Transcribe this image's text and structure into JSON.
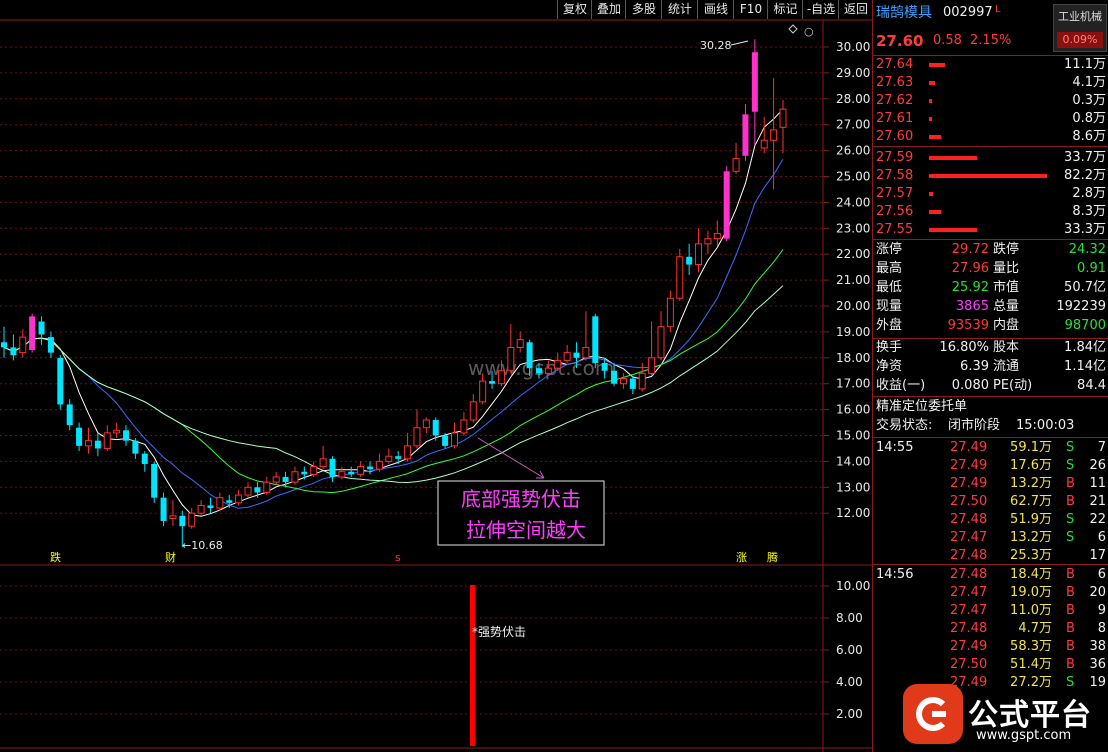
{
  "toolbar": {
    "items": [
      "复权",
      "叠加",
      "多股",
      "统计",
      "画线",
      "F10",
      "标记",
      "-自选",
      "返回"
    ]
  },
  "price_axis": {
    "labels": [
      "30.00",
      "29.00",
      "28.00",
      "27.00",
      "26.00",
      "25.00",
      "24.00",
      "23.00",
      "22.00",
      "21.00",
      "20.00",
      "19.00",
      "18.00",
      "17.00",
      "16.00",
      "15.00",
      "14.00",
      "13.00",
      "12.00"
    ]
  },
  "indicator_axis": {
    "labels": [
      "10.00",
      "8.00",
      "6.00",
      "4.00",
      "2.00"
    ]
  },
  "chart_annotations": {
    "high_label": "30.28",
    "low_label": "←10.68",
    "callout_line1": "底部强势伏击",
    "callout_line2": "拉伸空间越大",
    "indicator_label": "*强势伏击",
    "markers": [
      "跌",
      "财",
      "s",
      "涨",
      "腾"
    ],
    "watermark": "www.gspt.com"
  },
  "stock": {
    "name": "瑞鹄模具",
    "code": "002997",
    "flag": "L",
    "industry": "工业机械",
    "industry_change": "0.09%",
    "price": "27.60",
    "change": "0.58",
    "change_pct": "2.15%"
  },
  "order_book": {
    "asks": [
      {
        "price": "27.64",
        "vol": "11.1万"
      },
      {
        "price": "27.63",
        "vol": "4.1万"
      },
      {
        "price": "27.62",
        "vol": "0.3万"
      },
      {
        "price": "27.61",
        "vol": "0.8万"
      },
      {
        "price": "27.60",
        "vol": "8.6万"
      }
    ],
    "bids": [
      {
        "price": "27.59",
        "vol": "33.7万"
      },
      {
        "price": "27.58",
        "vol": "82.2万"
      },
      {
        "price": "27.57",
        "vol": "2.8万"
      },
      {
        "price": "27.56",
        "vol": "8.3万"
      },
      {
        "price": "27.55",
        "vol": "33.3万"
      }
    ]
  },
  "stats": {
    "limit_up_label": "涨停",
    "limit_up": "29.72",
    "limit_down_label": "跌停",
    "limit_down": "24.32",
    "high_label": "最高",
    "high": "27.96",
    "vol_ratio_label": "量比",
    "vol_ratio": "0.91",
    "low_label": "最低",
    "low": "25.92",
    "mktcap_label": "市值",
    "mktcap": "50.7亿",
    "cur_vol_label": "现量",
    "cur_vol": "3865",
    "total_vol_label": "总量",
    "total_vol": "192239",
    "outer_label": "外盘",
    "outer": "93539",
    "inner_label": "内盘",
    "inner": "98700",
    "turnover_label": "换手",
    "turnover": "16.80%",
    "equity_label": "股本",
    "equity": "1.84亿",
    "nav_label": "净资",
    "nav": "6.39",
    "float_label": "流通",
    "float": "1.14亿",
    "eps_label": "收益(一)",
    "eps": "0.080",
    "pe_label": "PE(动)",
    "pe": "84.4",
    "precise_label": "精准定位委托单",
    "status_label": "交易状态:",
    "status": "闭市阶段",
    "status_time": "15:00:03"
  },
  "ticks": [
    {
      "time": "14:55",
      "price": "27.49",
      "vol": "59.1万",
      "side": "S",
      "n": "7"
    },
    {
      "time": "",
      "price": "27.49",
      "vol": "17.6万",
      "side": "S",
      "n": "26"
    },
    {
      "time": "",
      "price": "27.49",
      "vol": "13.2万",
      "side": "B",
      "n": "11"
    },
    {
      "time": "",
      "price": "27.50",
      "vol": "62.7万",
      "side": "B",
      "n": "21"
    },
    {
      "time": "",
      "price": "27.48",
      "vol": "51.9万",
      "side": "S",
      "n": "22"
    },
    {
      "time": "",
      "price": "27.47",
      "vol": "13.2万",
      "side": "S",
      "n": "6"
    },
    {
      "time": "",
      "price": "27.48",
      "vol": "25.3万",
      "side": "",
      "n": "17"
    },
    {
      "time": "14:56",
      "price": "27.48",
      "vol": "18.4万",
      "side": "B",
      "n": "6"
    },
    {
      "time": "",
      "price": "27.47",
      "vol": "19.0万",
      "side": "B",
      "n": "20"
    },
    {
      "time": "",
      "price": "27.47",
      "vol": "11.0万",
      "side": "B",
      "n": "9"
    },
    {
      "time": "",
      "price": "27.48",
      "vol": "4.7万",
      "side": "B",
      "n": "8"
    },
    {
      "time": "",
      "price": "27.49",
      "vol": "58.3万",
      "side": "B",
      "n": "38"
    },
    {
      "time": "",
      "price": "27.50",
      "vol": "51.4万",
      "side": "B",
      "n": "36"
    },
    {
      "time": "",
      "price": "27.49",
      "vol": "27.2万",
      "side": "S",
      "n": "19"
    }
  ],
  "logo": {
    "text": "公式平台",
    "url": "www.gspt.com"
  },
  "colors": {
    "up": "#ff3b3b",
    "down": "#00e5ff",
    "strong": "#ff33cc",
    "ma1": "#ffffff",
    "ma2": "#3a6bff",
    "ma3": "#33ff33",
    "ma4": "#aaffcc",
    "frame": "#8b1a1a"
  }
}
